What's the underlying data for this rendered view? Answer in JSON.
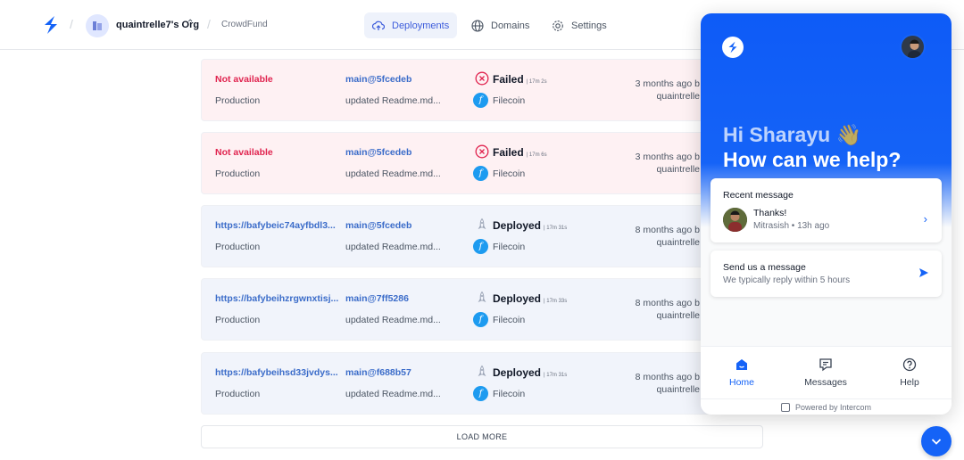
{
  "topbar": {
    "org_name": "quaintrelle7's Org",
    "project_name": "CrowdFund",
    "tabs": [
      {
        "label": "Deployments",
        "icon": "cloud-upload-icon",
        "active": true
      },
      {
        "label": "Domains",
        "icon": "globe-icon",
        "active": false
      },
      {
        "label": "Settings",
        "icon": "gear-icon",
        "active": false
      }
    ]
  },
  "deployments": [
    {
      "url": "Not available",
      "environment": "Production",
      "commit": "main@5fcedeb",
      "message": "updated Readme.md...",
      "status": "Failed",
      "duration": "17m 2s",
      "provider": "Filecoin",
      "time": "3 months ago b",
      "author": "quaintrelle"
    },
    {
      "url": "Not available",
      "environment": "Production",
      "commit": "main@5fcedeb",
      "message": "updated Readme.md...",
      "status": "Failed",
      "duration": "17m 6s",
      "provider": "Filecoin",
      "time": "3 months ago b",
      "author": "quaintrelle"
    },
    {
      "url": "https://bafybeic74ayfbdl3...",
      "environment": "Production",
      "commit": "main@5fcedeb",
      "message": "updated Readme.md...",
      "status": "Deployed",
      "duration": "17m 31s",
      "provider": "Filecoin",
      "time": "8 months ago b",
      "author": "quaintrelle"
    },
    {
      "url": "https://bafybeihzrgwnxtisj...",
      "environment": "Production",
      "commit": "main@7ff5286",
      "message": "updated Readme.md...",
      "status": "Deployed",
      "duration": "17m 33s",
      "provider": "Filecoin",
      "time": "8 months ago b",
      "author": "quaintrelle"
    },
    {
      "url": "https://bafybeihsd33jvdys...",
      "environment": "Production",
      "commit": "main@f688b57",
      "message": "updated Readme.md...",
      "status": "Deployed",
      "duration": "17m 31s",
      "provider": "Filecoin",
      "time": "8 months ago b",
      "author": "quaintrelle"
    }
  ],
  "load_more": "LOAD MORE",
  "intercom": {
    "greeting": "Hi Sharayu 👋",
    "help": "How can we help?",
    "recent_title": "Recent message",
    "recent_text": "Thanks!",
    "recent_meta": "Mitrasish • 13h ago",
    "send_title": "Send us a message",
    "send_sub": "We typically reply within 5 hours",
    "tabs": [
      "Home",
      "Messages",
      "Help"
    ],
    "powered": "Powered by Intercom"
  },
  "colors": {
    "accent": "#1563f7",
    "failed": "#e0244f",
    "link": "#3b6cc9",
    "provider": "#1d9bf0"
  }
}
